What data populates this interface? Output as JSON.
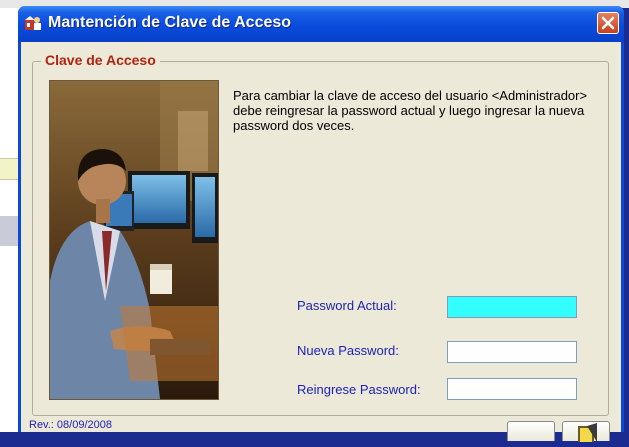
{
  "window": {
    "title": "Mantención de Clave de Acceso",
    "colors": {
      "titlebar": "#0a4bdc",
      "close": "#c8401e",
      "client": "#ece9d8"
    }
  },
  "group": {
    "title": "Clave de Acceso",
    "title_color": "#b2230e"
  },
  "instructions": "Para cambiar la clave de acceso del usuario <Administrador> debe reingresar la password actual y luego ingresar la nueva password dos veces.",
  "fields": {
    "current_password": {
      "label": "Password Actual:",
      "value": "",
      "focused": true
    },
    "new_password": {
      "label": "Nueva Password:",
      "value": ""
    },
    "confirm_password": {
      "label": "Reingrese Password:",
      "value": ""
    }
  },
  "footer": {
    "revision": "Rev.: 08/09/2008"
  },
  "icons": {
    "title": "app-icon",
    "close": "close-icon",
    "exit": "exit-door-icon"
  },
  "photo_description_icon": "user-photo"
}
